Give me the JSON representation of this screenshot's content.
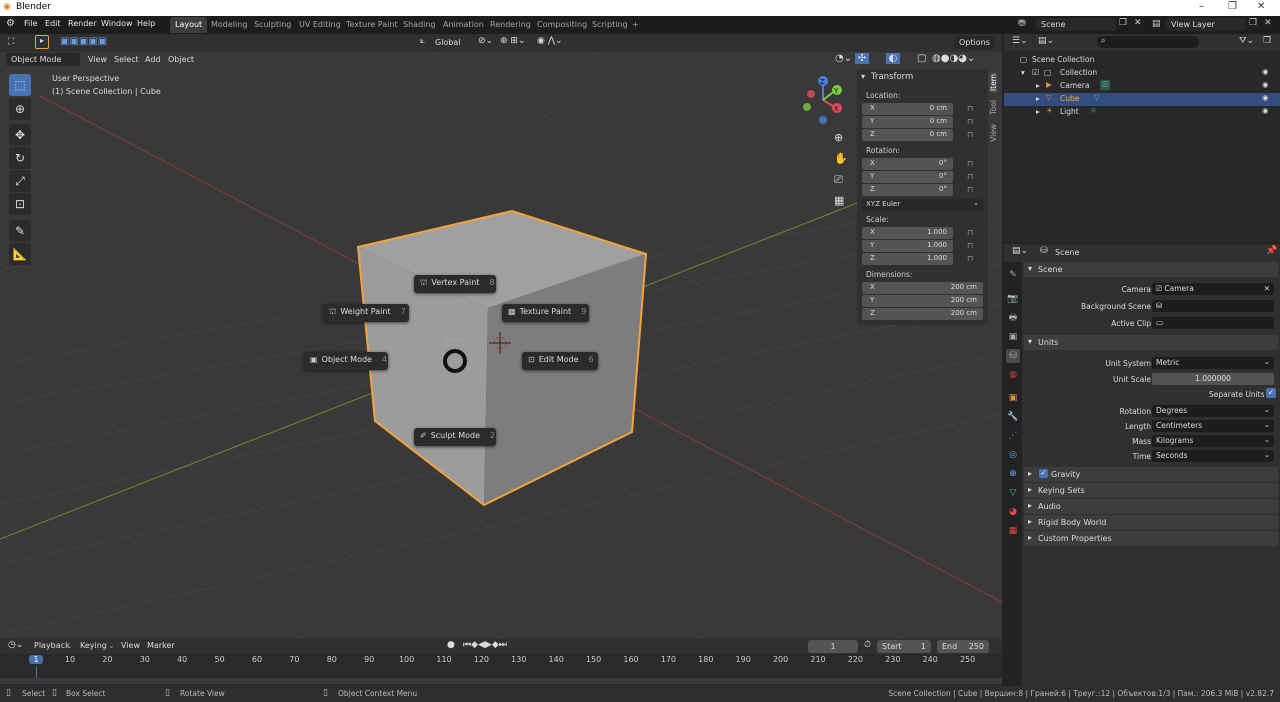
{
  "window": {
    "title": "Blender",
    "minimize": "–",
    "maximize": "❐",
    "close": "✕"
  },
  "menus": [
    "File",
    "Edit",
    "Render",
    "Window",
    "Help"
  ],
  "workspaces": [
    "Layout",
    "Modeling",
    "Sculpting",
    "UV Editing",
    "Texture Paint",
    "Shading",
    "Animation",
    "Rendering",
    "Compositing",
    "Scripting",
    "+"
  ],
  "scene_selector": {
    "scene": "Scene",
    "view_layer": "View Layer"
  },
  "viewport": {
    "transform_orientation": "Global",
    "options": "Options",
    "mode": "Object Mode",
    "menu": [
      "View",
      "Select",
      "Add",
      "Object"
    ],
    "overlay_title": "User Perspective",
    "overlay_subtitle": "(1) Scene Collection | Cube",
    "pie_center_label": "Mode",
    "pie": [
      {
        "label": "Vertex Paint",
        "key": "8"
      },
      {
        "label": "Weight Paint",
        "key": "7"
      },
      {
        "label": "Texture Paint",
        "key": "9"
      },
      {
        "label": "Object Mode",
        "key": "4"
      },
      {
        "label": "Edit Mode",
        "key": "6"
      },
      {
        "label": "Sculpt Mode",
        "key": "2"
      }
    ],
    "side_tabs": [
      "Item",
      "Tool",
      "View"
    ],
    "gizmo": {
      "x": "X",
      "y": "Y",
      "z": "Z"
    }
  },
  "npanel": {
    "title": "Transform",
    "location_label": "Location:",
    "location": [
      {
        "axis": "X",
        "value": "0 cm"
      },
      {
        "axis": "Y",
        "value": "0 cm"
      },
      {
        "axis": "Z",
        "value": "0 cm"
      }
    ],
    "rotation_label": "Rotation:",
    "rotation": [
      {
        "axis": "X",
        "value": "0°"
      },
      {
        "axis": "Y",
        "value": "0°"
      },
      {
        "axis": "Z",
        "value": "0°"
      }
    ],
    "rotation_mode": "XYZ Euler",
    "scale_label": "Scale:",
    "scale": [
      {
        "axis": "X",
        "value": "1.000"
      },
      {
        "axis": "Y",
        "value": "1.000"
      },
      {
        "axis": "Z",
        "value": "1.000"
      }
    ],
    "dimensions_label": "Dimensions:",
    "dimensions": [
      {
        "axis": "X",
        "value": "200 cm"
      },
      {
        "axis": "Y",
        "value": "200 cm"
      },
      {
        "axis": "Z",
        "value": "200 cm"
      }
    ]
  },
  "outliner": {
    "root": "Scene Collection",
    "collection": "Collection",
    "items": [
      {
        "name": "Camera"
      },
      {
        "name": "Cube"
      },
      {
        "name": "Light"
      }
    ]
  },
  "properties": {
    "context": "Scene",
    "scene_section": "Scene",
    "camera_label": "Camera",
    "camera_value": "Camera",
    "background_scene_label": "Background Scene",
    "active_clip_label": "Active Clip",
    "units_section": "Units",
    "unit_system_label": "Unit System",
    "unit_system": "Metric",
    "unit_scale_label": "Unit Scale",
    "unit_scale": "1.000000",
    "separate_units": "Separate Units",
    "rotation_label": "Rotation",
    "rotation": "Degrees",
    "length_label": "Length",
    "length": "Centimeters",
    "mass_label": "Mass",
    "mass": "Kilograms",
    "time_label": "Time",
    "time": "Seconds",
    "gravity": "Gravity",
    "keying_sets": "Keying Sets",
    "audio": "Audio",
    "rigid_body_world": "Rigid Body World",
    "custom_properties": "Custom Properties"
  },
  "timeline": {
    "menu": [
      "Playback",
      "Keying",
      "View",
      "Marker"
    ],
    "current_frame": "1",
    "start_label": "Start",
    "start": "1",
    "end_label": "End",
    "end": "250",
    "ruler": [
      "1",
      "10",
      "20",
      "30",
      "40",
      "50",
      "60",
      "70",
      "80",
      "90",
      "100",
      "110",
      "120",
      "130",
      "140",
      "150",
      "160",
      "170",
      "180",
      "190",
      "200",
      "210",
      "220",
      "230",
      "240",
      "250"
    ]
  },
  "statusbar": {
    "select": "Select",
    "box_select": "Box Select",
    "rotate_view": "Rotate View",
    "context_menu": "Object Context Menu",
    "stats": "Scene Collection | Cube | Вершин:8 | Граней:6 | Треуг.:12 | Объектов:1/3 | Пам.: 206.3 MiB | v2.82.7"
  },
  "colors": {
    "accent": "#4772b3",
    "selection": "#f2a33a",
    "background": "#393939"
  }
}
